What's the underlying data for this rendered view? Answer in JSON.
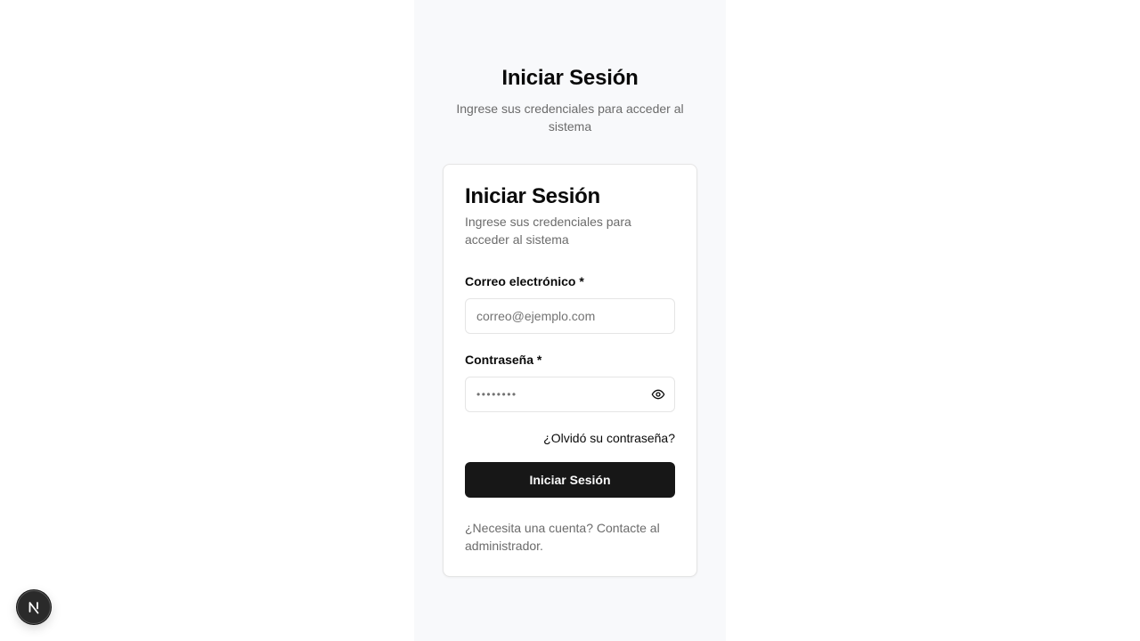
{
  "header": {
    "title": "Iniciar Sesión",
    "subtitle": "Ingrese sus credenciales para acceder al sistema"
  },
  "card": {
    "title": "Iniciar Sesión",
    "description": "Ingrese sus credenciales para acceder al sistema",
    "email": {
      "label": "Correo electrónico *",
      "placeholder": "correo@ejemplo.com",
      "value": ""
    },
    "password": {
      "label": "Contraseña *",
      "placeholder": "••••••••",
      "toggle_icon": "eye-icon"
    },
    "forgot_link": "¿Olvidó su contraseña?",
    "submit_label": "Iniciar Sesión",
    "footer_note": "¿Necesita una cuenta? Contacte al administrador."
  },
  "badge": {
    "icon": "nextjs-logo-icon"
  },
  "colors": {
    "page_background": "#ffffff",
    "column_background": "#f8f9fb",
    "card_border": "#e5e5e5",
    "primary_button": "#171717",
    "muted_text": "#6b6b6b"
  }
}
